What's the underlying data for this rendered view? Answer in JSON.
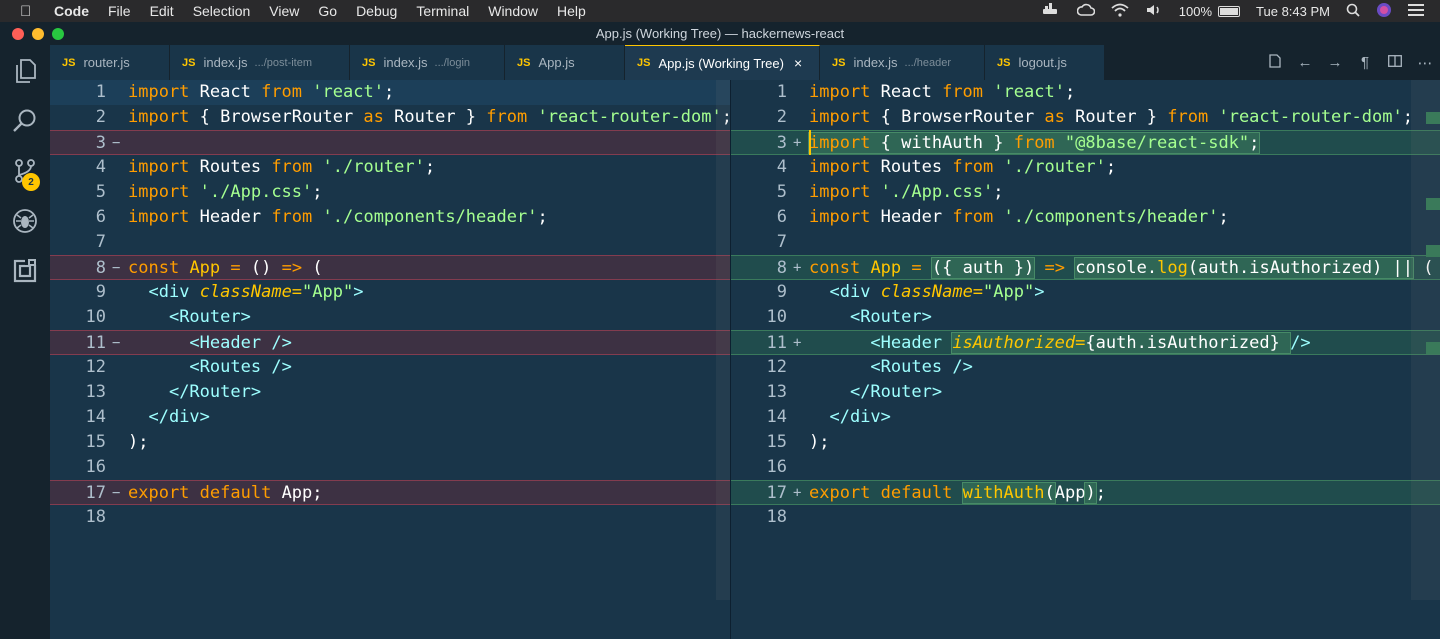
{
  "menubar": {
    "app": "Code",
    "items": [
      "File",
      "Edit",
      "Selection",
      "View",
      "Go",
      "Debug",
      "Terminal",
      "Window",
      "Help"
    ],
    "battery": "100%",
    "clock": "Tue 8:43 PM"
  },
  "window": {
    "title": "App.js (Working Tree) — hackernews-react"
  },
  "activity": {
    "scm_badge": "2"
  },
  "tabs": [
    {
      "label": "router.js",
      "dir": ""
    },
    {
      "label": "index.js",
      "dir": ".../post-item"
    },
    {
      "label": "index.js",
      "dir": ".../login"
    },
    {
      "label": "App.js",
      "dir": ""
    },
    {
      "label": "App.js (Working Tree)",
      "dir": "",
      "active": true,
      "close": "×"
    },
    {
      "label": "index.js",
      "dir": ".../header"
    },
    {
      "label": "logout.js",
      "dir": ""
    }
  ],
  "tab_badge": "JS",
  "left_lines": [
    "1",
    "2",
    "3",
    "4",
    "5",
    "6",
    "7",
    "8",
    "9",
    "10",
    "11",
    "12",
    "13",
    "14",
    "15",
    "16",
    "17",
    "18"
  ],
  "right_lines": [
    "1",
    "2",
    "3",
    "4",
    "5",
    "6",
    "7",
    "8",
    "9",
    "10",
    "11",
    "12",
    "13",
    "14",
    "15",
    "16",
    "17",
    "18"
  ],
  "markers": {
    "removed": "−",
    "added": "+"
  },
  "colors": {
    "accent": "#ffc600",
    "background": "#193549",
    "keyword": "#ff9d00",
    "string": "#a5ff90",
    "tag": "#9effff"
  }
}
